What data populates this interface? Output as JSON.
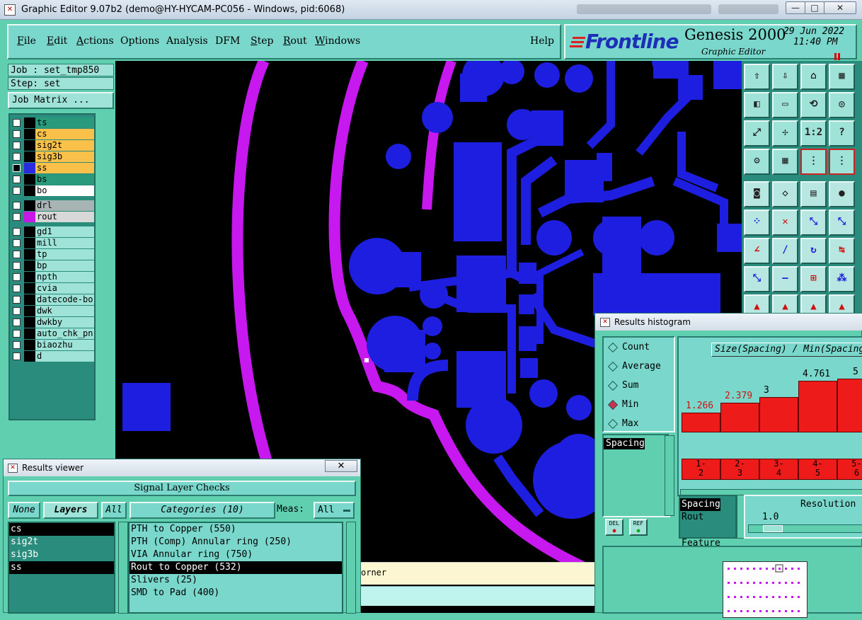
{
  "window": {
    "title": "Graphic Editor 9.07b2 (demo@HY-HYCAM-PC056 - Windows, pid:6068)",
    "minimize": "—",
    "maximize": "□",
    "close": "✕"
  },
  "menu": {
    "items": [
      "File",
      "Edit",
      "Actions",
      "Options",
      "Analysis",
      "DFM",
      "Step",
      "Rout",
      "Windows"
    ],
    "help": "Help"
  },
  "brand": {
    "logo": "Frontline",
    "product": "Genesis 2000",
    "subtitle": "Graphic Editor",
    "date": "29 Jun 2022",
    "time": "11:40 PM"
  },
  "left": {
    "job": "Job : set_tmp850",
    "step": "Step: set",
    "job_matrix": "Job Matrix ...",
    "layers": [
      {
        "name": "ts",
        "bg": "#2a9a7c",
        "swatch": "#000000"
      },
      {
        "name": "cs",
        "bg": "#f9c14a",
        "swatch": "#000000"
      },
      {
        "name": "sig2t",
        "bg": "#f9c14a",
        "swatch": "#000000"
      },
      {
        "name": "sig3b",
        "bg": "#f9c14a",
        "swatch": "#000000"
      },
      {
        "name": "ss",
        "bg": "#f9c14a",
        "swatch": "#2a2ae0",
        "active": true
      },
      {
        "name": "bs",
        "bg": "#2a9a7c",
        "swatch": "#000000"
      },
      {
        "name": "bo",
        "bg": "#ffffff",
        "swatch": "#000000"
      },
      {
        "name": "drl",
        "bg": "#a8b4b4",
        "swatch": "#000000"
      },
      {
        "name": "rout",
        "bg": "#d8d8d8",
        "swatch": "#c818e8"
      },
      {
        "name": "gd1",
        "bg": "#9fe3d8",
        "swatch": "#000000"
      },
      {
        "name": "mill",
        "bg": "#9fe3d8",
        "swatch": "#000000"
      },
      {
        "name": "tp",
        "bg": "#9fe3d8",
        "swatch": "#000000"
      },
      {
        "name": "bp",
        "bg": "#9fe3d8",
        "swatch": "#000000"
      },
      {
        "name": "npth",
        "bg": "#9fe3d8",
        "swatch": "#000000"
      },
      {
        "name": "cvia",
        "bg": "#9fe3d8",
        "swatch": "#000000"
      },
      {
        "name": "datecode-bo",
        "bg": "#9fe3d8",
        "swatch": "#000000"
      },
      {
        "name": "dwk",
        "bg": "#9fe3d8",
        "swatch": "#000000"
      },
      {
        "name": "dwkby",
        "bg": "#9fe3d8",
        "swatch": "#000000"
      },
      {
        "name": "auto_chk_pn",
        "bg": "#9fe3d8",
        "swatch": "#000000"
      },
      {
        "name": "biaozhu",
        "bg": "#9fe3d8",
        "swatch": "#000000"
      },
      {
        "name": "d",
        "bg": "#9fe3d8",
        "swatch": "#000000"
      }
    ]
  },
  "results_viewer": {
    "title": "Results viewer",
    "close": "✕",
    "group": "Signal Layer Checks",
    "none": "None",
    "layers_label": "Layers",
    "all": "All",
    "categories": "Categories (10)",
    "meas_label": "Meas:",
    "meas_value": "All",
    "layer_list": [
      {
        "name": "cs",
        "selected": true
      },
      {
        "name": "sig2t",
        "selected": false
      },
      {
        "name": "sig3b",
        "selected": false
      },
      {
        "name": "ss",
        "selected": true
      }
    ],
    "category_list": [
      {
        "name": "PTH to Copper (550)",
        "selected": false
      },
      {
        "name": "PTH (Comp) Annular ring (250)",
        "selected": false
      },
      {
        "name": "VIA Annular ring (750)",
        "selected": false
      },
      {
        "name": "Rout to Copper (532)",
        "selected": true
      },
      {
        "name": "Slivers (25)",
        "selected": false
      },
      {
        "name": "SMD to Pad (400)",
        "selected": false
      }
    ]
  },
  "status_strip": {
    "text": "orner"
  },
  "histogram": {
    "title": "Results histogram",
    "modes": [
      {
        "label": "Count",
        "on": false
      },
      {
        "label": "Average",
        "on": false
      },
      {
        "label": "Sum",
        "on": false
      },
      {
        "label": "Min",
        "on": true
      },
      {
        "label": "Max",
        "on": false
      }
    ],
    "measure_list": [
      "Spacing"
    ],
    "del": "DEL",
    "ref": "REF",
    "filter_list": [
      {
        "name": "Spacing",
        "selected": true
      },
      {
        "name": "Rout",
        "selected": false
      },
      {
        "name": "Feature",
        "selected": false
      }
    ],
    "resolution_label": "Resolution",
    "resolution_value": "1.0",
    "plot_title": "Size(Spacing) / Min(Spacing)"
  },
  "chart_data": {
    "type": "bar",
    "title": "Size(Spacing) / Min(Spacing)",
    "categories": [
      "1-2",
      "2-3",
      "3-4",
      "4-5",
      "5-6"
    ],
    "values": [
      1.266,
      2.379,
      3,
      4.761,
      5
    ],
    "value_labels": [
      "1.266",
      "2.379",
      "3",
      "4.761",
      "5"
    ],
    "xlabel": "",
    "ylabel": ""
  },
  "colors": {
    "copper": "#1e1ee0",
    "rout": "#c818f0",
    "panel": "#5fcfb0",
    "bar": "#ee1b1b"
  }
}
